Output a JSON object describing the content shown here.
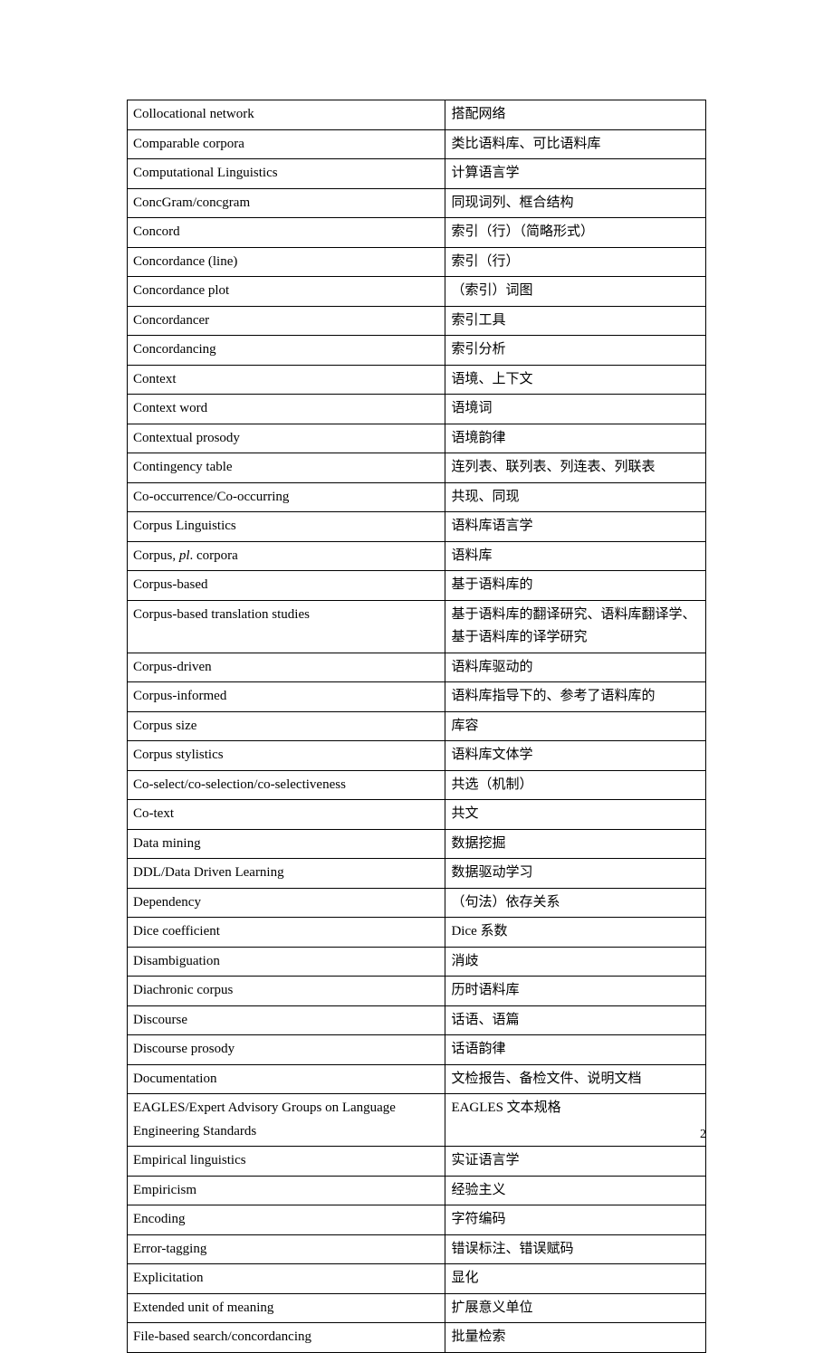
{
  "page_number": "2",
  "rows": [
    {
      "en": "Collocational network",
      "zh": "搭配网络"
    },
    {
      "en": "Comparable corpora",
      "zh": "类比语料库、可比语料库"
    },
    {
      "en": "Computational Linguistics",
      "zh": "计算语言学"
    },
    {
      "en": "ConcGram/concgram",
      "zh": "同现词列、框合结构"
    },
    {
      "en": "Concord",
      "zh": "索引（行）（简略形式）"
    },
    {
      "en": "Concordance (line)",
      "zh": "索引（行）"
    },
    {
      "en": "Concordance plot",
      "zh": "（索引）词图"
    },
    {
      "en": "Concordancer",
      "zh": "索引工具"
    },
    {
      "en": "Concordancing",
      "zh": "索引分析"
    },
    {
      "en": "Context",
      "zh": "语境、上下文"
    },
    {
      "en": "Context word",
      "zh": "语境词"
    },
    {
      "en": "Contextual prosody",
      "zh": "语境韵律"
    },
    {
      "en": "Contingency table",
      "zh": "连列表、联列表、列连表、列联表"
    },
    {
      "en": "Co-occurrence/Co-occurring",
      "zh": "共现、同现"
    },
    {
      "en": "Corpus Linguistics",
      "zh": "语料库语言学"
    },
    {
      "en_prefix": "Corpus, ",
      "en_italic": "pl",
      "en_suffix": ". corpora",
      "zh": "语料库"
    },
    {
      "en": "Corpus-based",
      "zh": "基于语料库的"
    },
    {
      "en": "Corpus-based translation studies",
      "zh": "基于语料库的翻译研究、语料库翻译学、基于语料库的译学研究"
    },
    {
      "en": "Corpus-driven",
      "zh": "语料库驱动的"
    },
    {
      "en": "Corpus-informed",
      "zh": "语料库指导下的、参考了语料库的"
    },
    {
      "en": "Corpus size",
      "zh": "库容"
    },
    {
      "en": "Corpus stylistics",
      "zh": "语料库文体学"
    },
    {
      "en": "Co-select/co-selection/co-selectiveness",
      "zh": "共选（机制）"
    },
    {
      "en": "Co-text",
      "zh": "共文"
    },
    {
      "en": "Data mining",
      "zh": "数据挖掘"
    },
    {
      "en": "DDL/Data Driven Learning",
      "zh": "数据驱动学习"
    },
    {
      "en": "Dependency",
      "zh": "（句法）依存关系"
    },
    {
      "en": "Dice coefficient",
      "zh": "Dice 系数"
    },
    {
      "en": "Disambiguation",
      "zh": "消歧"
    },
    {
      "en": "Diachronic corpus",
      "zh": "历时语料库"
    },
    {
      "en": "Discourse",
      "zh": "话语、语篇"
    },
    {
      "en": "Discourse prosody",
      "zh": "话语韵律"
    },
    {
      "en": "Documentation",
      "zh": "文检报告、备检文件、说明文档"
    },
    {
      "en": "EAGLES/Expert Advisory Groups on Language Engineering Standards",
      "zh": "EAGLES 文本规格"
    },
    {
      "en": "Empirical linguistics",
      "zh": "实证语言学"
    },
    {
      "en": "Empiricism",
      "zh": "经验主义"
    },
    {
      "en": "Encoding",
      "zh": "字符编码"
    },
    {
      "en": "Error-tagging",
      "zh": "错误标注、错误赋码"
    },
    {
      "en": "Explicitation",
      "zh": "显化"
    },
    {
      "en": "Extended unit of meaning",
      "zh": "扩展意义单位"
    },
    {
      "en": "File-based search/concordancing",
      "zh": "批量检索"
    }
  ]
}
